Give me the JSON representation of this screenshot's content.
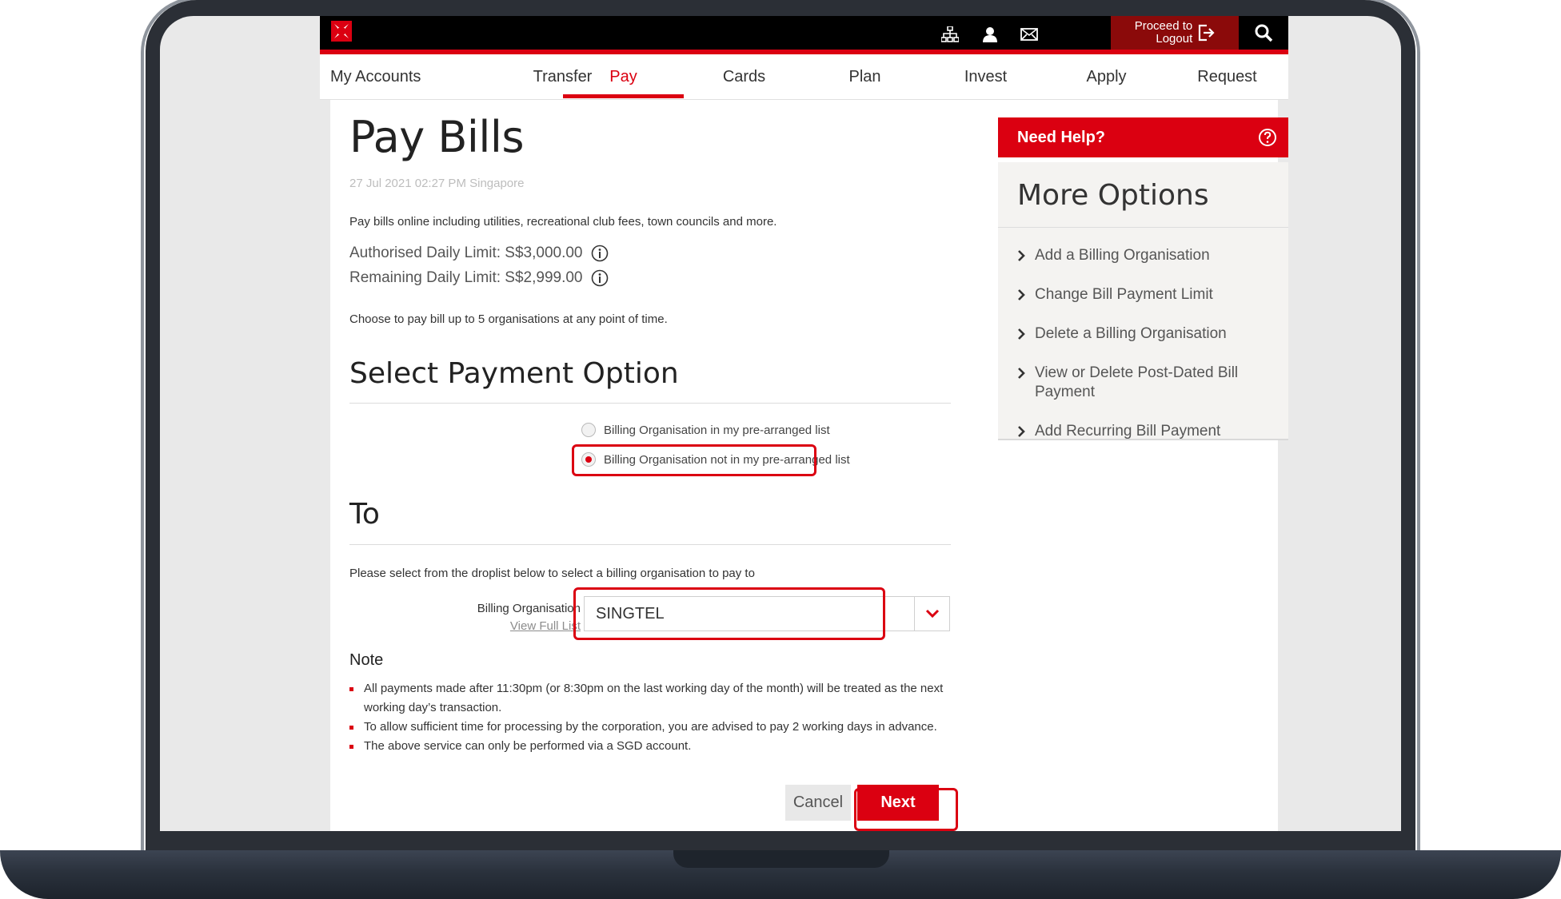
{
  "topbar": {
    "logout_line1": "Proceed to",
    "logout_line2": "Logout",
    "icons": [
      "sitemap-icon",
      "user-icon",
      "mail-icon",
      "logout-icon",
      "search-icon"
    ]
  },
  "nav": {
    "items": [
      {
        "label": "My Accounts"
      },
      {
        "label": "Transfer"
      },
      {
        "label": "Pay"
      },
      {
        "label": "Cards"
      },
      {
        "label": "Plan"
      },
      {
        "label": "Invest"
      },
      {
        "label": "Apply"
      },
      {
        "label": "Request"
      }
    ],
    "active": "Pay"
  },
  "main": {
    "title": "Pay Bills",
    "timestamp": "27 Jul 2021 02:27 PM Singapore",
    "intro": "Pay bills online including utilities, recreational club fees, town councils and more.",
    "authorised_limit": "Authorised Daily Limit: S$3,000.00",
    "remaining_limit": "Remaining Daily Limit: S$2,999.00",
    "choose_text": "Choose to pay bill up to 5 organisations at any point of time.",
    "payment_option_heading": "Select Payment Option",
    "option_1": "Billing Organisation in my pre-arranged list",
    "option_2": "Billing Organisation not in my pre-arranged list",
    "to_heading": "To",
    "select_instruction": "Please select from the droplist below to select a billing organisation to pay to",
    "billing_org_label": "Billing Organisation",
    "view_full_list": "View Full List",
    "billing_org_value": "SINGTEL",
    "note_heading": "Note",
    "notes": [
      "All payments made after 11:30pm (or 8:30pm on the last working day of the month) will be treated as the next working day’s transaction.",
      "To allow sufficient time for processing by the corporation, you are advised to pay 2 working days in advance.",
      "The above service can only be performed via a SGD account."
    ],
    "cancel_label": "Cancel",
    "next_label": "Next"
  },
  "sidebar": {
    "help_label": "Need Help?",
    "more_heading": "More Options",
    "options": [
      {
        "label": "Add a Billing Organisation"
      },
      {
        "label": "Change Bill Payment Limit"
      },
      {
        "label": "Delete a Billing Organisation"
      },
      {
        "label": "View or Delete Post-Dated Bill Payment"
      },
      {
        "label": "Add Recurring Bill Payment"
      }
    ]
  },
  "colors": {
    "accent": "#db0011",
    "topbar": "#000000",
    "logout_bg": "#8b0a0a"
  }
}
